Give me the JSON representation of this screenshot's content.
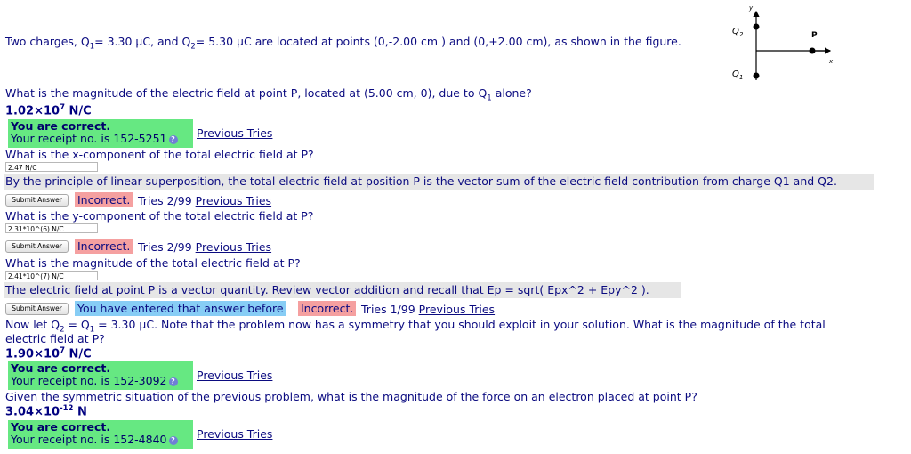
{
  "problem": {
    "intro_a": "Two charges, Q",
    "intro_b": "= 3.30 μC, and Q",
    "intro_c": "= 5.30 μC are located at points (0,-2.00 cm ) and (0,+2.00 cm), as shown in the figure.",
    "sub1": "1",
    "sub2": "2"
  },
  "figure": {
    "y_label": "y",
    "x_label": "x",
    "q2_label": "Q",
    "q2_sub": "2",
    "q1_label": "Q",
    "q1_sub": "1",
    "p_label": "P"
  },
  "q1": {
    "text_a": "What is the magnitude of the electric field at point P, located at (5.00 cm, 0), due to Q",
    "sub": "1",
    "text_b": " alone?",
    "answer_base": "1.02×10",
    "answer_exp": "7",
    "answer_unit": " N/C",
    "correct_title": "You are correct.",
    "receipt": "Your receipt no. is 152-5251",
    "previous_tries": "Previous Tries"
  },
  "q2": {
    "text": "What is the x-component of the total electric field at P?",
    "input_value": "2.47 N/C",
    "hint": "By the principle of linear superposition, the total electric field at position P is the vector sum of the electric field contribution from charge Q1 and Q2.",
    "submit": "Submit Answer",
    "status": "Incorrect.",
    "tries": " Tries 2/99 ",
    "previous_tries": "Previous Tries"
  },
  "q3": {
    "text": "What is the y-component of the total electric field at P?",
    "input_value": "2.31*10^(6) N/C",
    "submit": "Submit Answer",
    "status": "Incorrect.",
    "tries": " Tries 2/99 ",
    "previous_tries": "Previous Tries"
  },
  "q4": {
    "text": "What is the magnitude of the total electric field at P?",
    "input_value": "2.41*10^(7) N/C",
    "hint": "The electric field at point P is a vector quantity. Review vector addition and recall that Ep = sqrt( Epx^2 + Epy^2 ).",
    "submit": "Submit Answer",
    "entered": "You have entered that answer before",
    "status": "Incorrect.",
    "tries": " Tries 1/99 ",
    "previous_tries": "Previous Tries"
  },
  "q5": {
    "text_a": "Now let Q",
    "sub_a": "2",
    "text_b": " = Q",
    "sub_b": "1",
    "text_c": " = 3.30 μC. Note that the problem now has a symmetry that you should exploit in your solution. What is the magnitude of the total",
    "text_line2": "electric field at P?",
    "answer_base": "1.90×10",
    "answer_exp": "7",
    "answer_unit": " N/C",
    "correct_title": "You are correct.",
    "receipt": "Your receipt no. is 152-3092",
    "previous_tries": "Previous Tries"
  },
  "q6": {
    "text": "Given the symmetric situation of the previous problem, what is the magnitude of the force on an electron placed at point P?",
    "answer_base": "3.04×10",
    "answer_exp": "-12",
    "answer_unit": " N",
    "correct_title": "You are correct.",
    "receipt": "Your receipt no. is 152-4840",
    "previous_tries": "Previous Tries"
  },
  "colors": {
    "text": "#0b0b80",
    "correct_bg": "#66e882",
    "incorrect_bg": "#f5a0a0",
    "entered_bg": "#87cdf5",
    "hint_bg": "#e6e6e6"
  },
  "icons": [
    "info-icon",
    "charge-dot-icon",
    "arrow-icon"
  ]
}
